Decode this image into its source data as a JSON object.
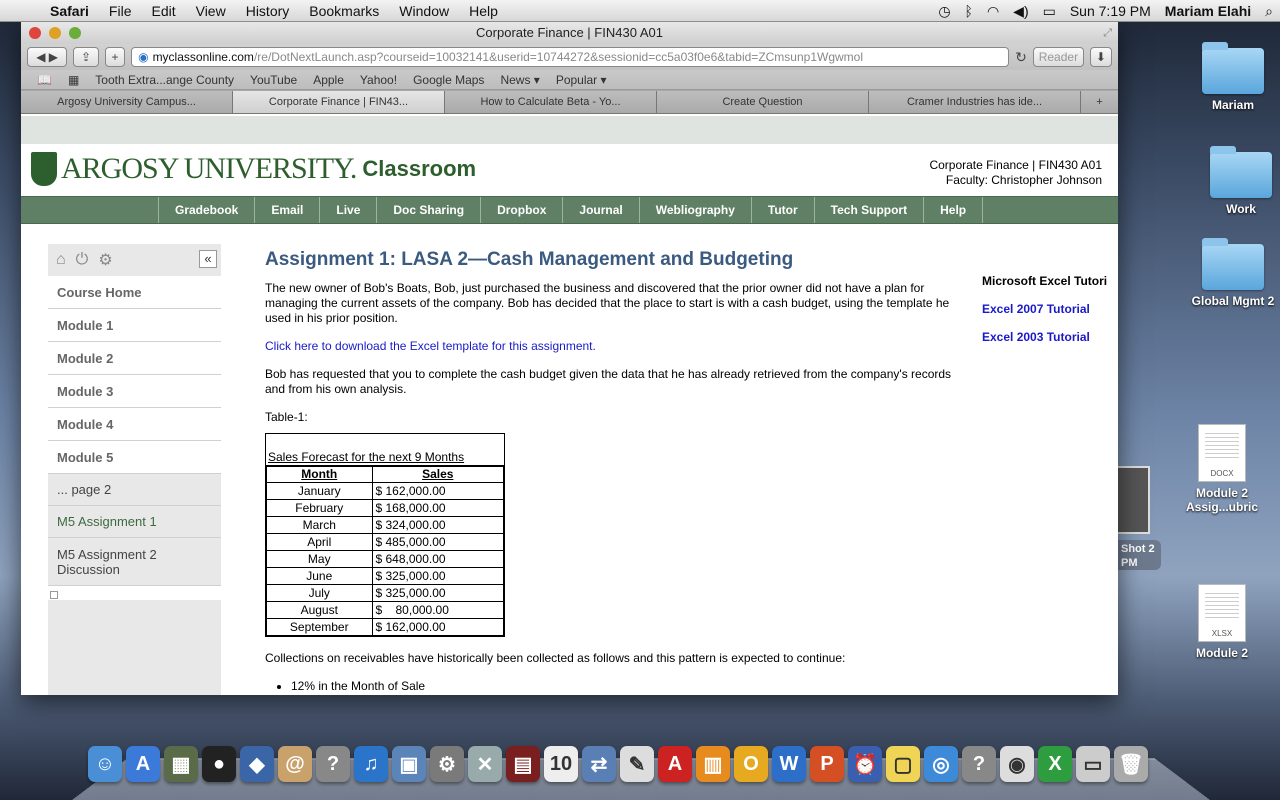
{
  "menubar": {
    "app": "Safari",
    "items": [
      "File",
      "Edit",
      "View",
      "History",
      "Bookmarks",
      "Window",
      "Help"
    ],
    "clock": "Sun 7:19 PM",
    "user": "Mariam Elahi"
  },
  "desktop": {
    "folders": [
      "Mariam",
      "Work",
      "Global Mgmt 2"
    ],
    "files": [
      {
        "type": "DOCX",
        "label": "Module 2 Assig...ubric"
      },
      {
        "type": "XLSX",
        "label": "Module 2"
      }
    ],
    "screenshot_label": "Shot 2 PM"
  },
  "window": {
    "title": "Corporate Finance | FIN430 A01",
    "url_domain": "myclassonline.com",
    "url_rest": "/re/DotNextLaunch.asp?courseid=10032141&userid=10744272&sessionid=cc5a03f0e6&tabid=ZCmsunp1Wgwmol",
    "reader_label": "Reader",
    "bookmarks": [
      "Tooth Extra...ange County",
      "YouTube",
      "Apple",
      "Yahoo!",
      "Google Maps",
      "News ▾",
      "Popular ▾"
    ],
    "tabs": [
      {
        "label": "Argosy University Campus...",
        "active": false
      },
      {
        "label": "Corporate Finance | FIN43...",
        "active": true
      },
      {
        "label": "How to Calculate Beta - Yo...",
        "active": false
      },
      {
        "label": "Create Question",
        "active": false
      },
      {
        "label": "Cramer Industries has ide...",
        "active": false
      }
    ]
  },
  "site": {
    "logo_text": "ARGOSY UNIVERSITY.",
    "logo_classroom": "Classroom",
    "course": "Corporate Finance | FIN430 A01",
    "faculty": "Faculty:  Christopher Johnson",
    "nav": [
      "Gradebook",
      "Email",
      "Live",
      "Doc Sharing",
      "Dropbox",
      "Journal",
      "Webliography",
      "Tutor",
      "Tech Support",
      "Help"
    ],
    "sidebar": {
      "collapse": "«",
      "modules": [
        "Course Home",
        "Module 1",
        "Module 2",
        "Module 3",
        "Module 4",
        "Module 5"
      ],
      "sub": [
        "... page 2",
        "M5 Assignment 1",
        "M5 Assignment 2 Discussion"
      ]
    }
  },
  "assignment": {
    "title": "Assignment 1: LASA 2—Cash Management and Budgeting",
    "para1": "The new owner of Bob's Boats, Bob, just purchased the business and discovered that the prior owner did not have a plan for managing the current assets of the company.  Bob has decided that the place to start is with a cash budget, using the template he used in his prior position.",
    "download_link": "Click here to download the Excel template for this assignment.",
    "para2": "Bob has requested that you to complete the cash budget given the data that he has already retrieved from the company's records and from his own analysis.",
    "table_label": "Table-1:",
    "table_caption": "Sales Forecast for the next 9 Months",
    "table_headers": [
      "Month",
      "Sales"
    ],
    "table_rows": [
      [
        "January",
        "$ 162,000.00"
      ],
      [
        "February",
        "$ 168,000.00"
      ],
      [
        "March",
        "$ 324,000.00"
      ],
      [
        "April",
        "$ 485,000.00"
      ],
      [
        "May",
        "$ 648,000.00"
      ],
      [
        "June",
        "$ 325,000.00"
      ],
      [
        "July",
        "$ 325,000.00"
      ],
      [
        "August",
        "$    80,000.00"
      ],
      [
        "September",
        "$ 162,000.00"
      ]
    ],
    "para3": "Collections on receivables have historically been collected as follows and this pattern is expected to continue:",
    "bullet1": "12% in the Month of Sale"
  },
  "tutorials": {
    "heading": "Microsoft Excel Tutori",
    "links": [
      "Excel 2007 Tutorial",
      "Excel 2003 Tutorial"
    ]
  },
  "dock": [
    "Finder",
    "App Store",
    "Photo Booth",
    "FaceTime",
    "Preview",
    "Contacts",
    "Help",
    "iTunes",
    "iPhoto",
    "System Preferences",
    "Boot Camp",
    "Photo Booth",
    "Calendar",
    "Migration",
    "TextEdit",
    "Acrobat",
    "iBooks",
    "Outlook",
    "Word",
    "PowerPoint",
    "Clock",
    "Stickies",
    "Safari",
    "Help",
    "Chrome",
    "Excel",
    "Downloads",
    "Trash"
  ],
  "dock_icons": [
    "finder-icon",
    "appstore-icon",
    "photobooth-icon",
    "facetime-icon",
    "preview-icon",
    "contacts-icon",
    "help-icon",
    "itunes-icon",
    "iphoto-icon",
    "sysprefs-icon",
    "bootcamp-icon",
    "photobooth2-icon",
    "calendar-icon",
    "migration-icon",
    "textedit-icon",
    "acrobat-icon",
    "ibooks-icon",
    "outlook-icon",
    "word-icon",
    "powerpoint-icon",
    "clock-icon",
    "stickies-icon",
    "safari-icon",
    "help2-icon",
    "chrome-icon",
    "excel-icon",
    "downloads-icon",
    "trash-icon"
  ],
  "dock_glyphs": [
    "☺",
    "A",
    "▦",
    "●",
    "◆",
    "@",
    "?",
    "♫",
    "▣",
    "⚙",
    "✕",
    "▤",
    "10",
    "⇄",
    "✎",
    "A",
    "▥",
    "O",
    "W",
    "P",
    "⏰",
    "▢",
    "◎",
    "?",
    "◉",
    "X",
    "▭",
    "🗑"
  ],
  "dock_colors": [
    "#4a8fd6",
    "#3b7ad9",
    "#5a6b4a",
    "#222",
    "#3a66a8",
    "#c9a16b",
    "#888",
    "#2a74c9",
    "#5b84b8",
    "#7a7a7a",
    "#9aa",
    "#7a1f1f",
    "#eee",
    "#5a7fb5",
    "#ddd",
    "#c22",
    "#e88b1e",
    "#e6a91f",
    "#2d6ec9",
    "#d45024",
    "#3a5fb0",
    "#f0d455",
    "#3d8ad8",
    "#888",
    "#ddd",
    "#2e9d3f",
    "#ccc",
    "#aaa"
  ]
}
